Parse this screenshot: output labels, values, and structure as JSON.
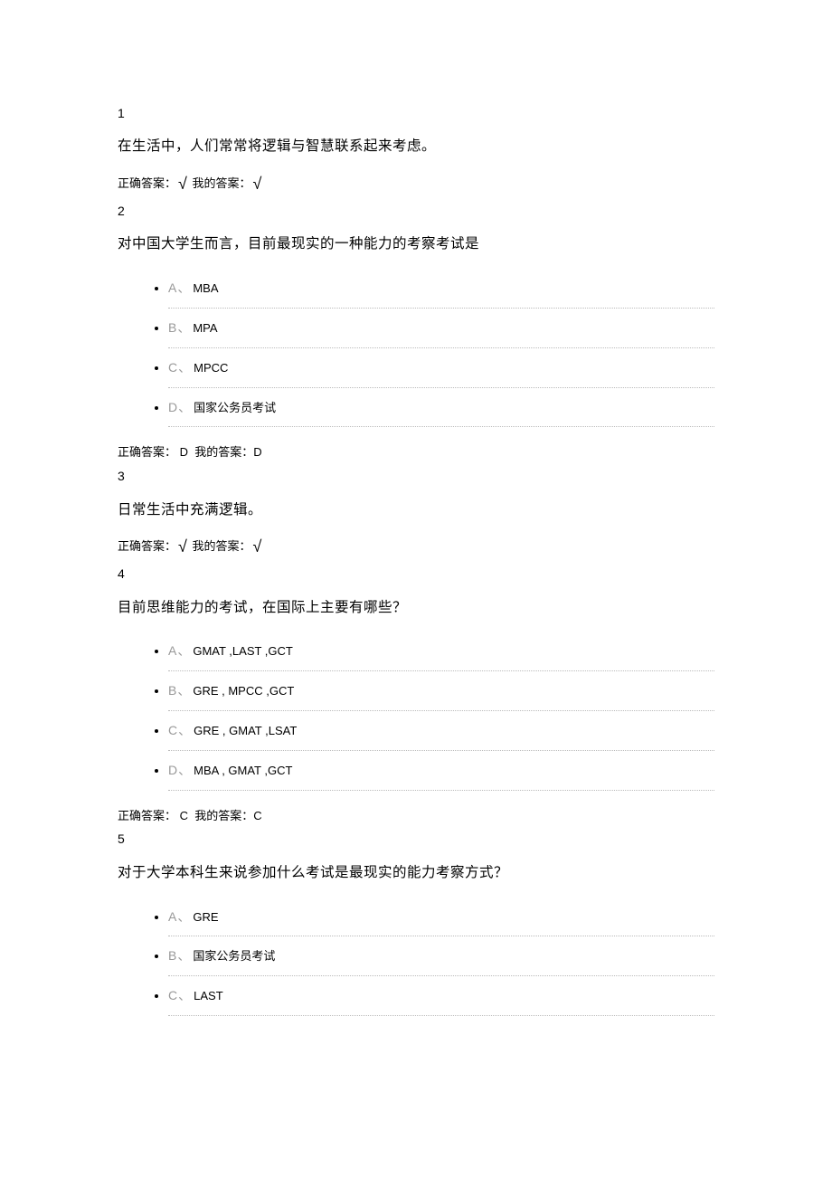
{
  "labels": {
    "correct": "正确答案：",
    "mine": "我的答案：",
    "tick": "√"
  },
  "questions": [
    {
      "num": "1",
      "text": "在生活中，人们常常将逻辑与智慧联系起来考虑。",
      "type": "tf",
      "correct": "√",
      "mine": "√"
    },
    {
      "num": "2",
      "text": "对中国大学生而言，目前最现实的一种能力的考察考试是",
      "type": "mc",
      "options": [
        {
          "letter": "A、",
          "text": "MBA"
        },
        {
          "letter": "B、",
          "text": "MPA"
        },
        {
          "letter": "C、",
          "text": "MPCC"
        },
        {
          "letter": "D、",
          "text": "国家公务员考试"
        }
      ],
      "correct": "D",
      "mine": "D"
    },
    {
      "num": "3",
      "text": "日常生活中充满逻辑。",
      "type": "tf",
      "correct": "√",
      "mine": "√"
    },
    {
      "num": "4",
      "text": "目前思维能力的考试，在国际上主要有哪些？",
      "type": "mc",
      "options": [
        {
          "letter": "A、",
          "text": "GMAT ,LAST ,GCT"
        },
        {
          "letter": "B、",
          "text": "GRE , MPCC ,GCT"
        },
        {
          "letter": "C、",
          "text": "GRE , GMAT ,LSAT"
        },
        {
          "letter": "D、",
          "text": "MBA , GMAT ,GCT"
        }
      ],
      "correct": "C",
      "mine": "C"
    },
    {
      "num": "5",
      "text": "对于大学本科生来说参加什么考试是最现实的能力考察方式？",
      "type": "mc_partial",
      "options": [
        {
          "letter": "A、",
          "text": "GRE"
        },
        {
          "letter": "B、",
          "text": "国家公务员考试"
        },
        {
          "letter": "C、",
          "text": "LAST"
        }
      ]
    }
  ]
}
